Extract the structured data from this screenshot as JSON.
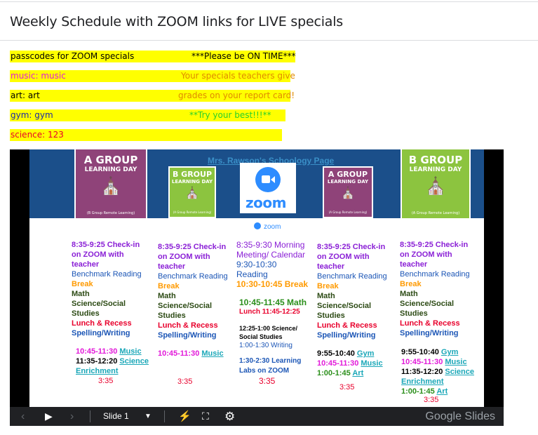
{
  "page": {
    "title": "Weekly Schedule with ZOOM links for LIVE specials"
  },
  "highlights": [
    {
      "left": "passcodes for ZOOM specials",
      "right": "***Please be ON TIME***",
      "left_color": "#000000",
      "right_color": "#000000"
    },
    {
      "left": "music: music",
      "right": "Your specials teachers give",
      "left_color": "#e21ad9",
      "right_color": "#e08a00"
    },
    {
      "left": "art: art",
      "right": "grades on your report card!",
      "left_color": "#000000",
      "right_color": "#e08a00"
    },
    {
      "left": "gym: gym",
      "right": "**Try your best!!!**",
      "left_color": "#1c2aa6",
      "right_color": "#2ad12a"
    },
    {
      "left": "science: 123",
      "right": "",
      "left_color": "#e8002c",
      "right_color": "#000000"
    }
  ],
  "slide": {
    "schoology_link": "Mrs. Rawson's Schoology Page",
    "badges": {
      "a_line1": "A GROUP",
      "a_line2": "LEARNING DAY",
      "a_foot": "(A Group Remote Learning)",
      "a_foot_b": "(B Group Remote Learning)",
      "b_line1": "B GROUP",
      "b_line2": "LEARNING DAY",
      "b_foot": "(A Group Remote Learning)"
    },
    "zoom_word": "zoom",
    "zoom_small": "zoom",
    "columns": {
      "mon": {
        "checkin": [
          "8:35-9:25 Check-in",
          "on ZOOM with",
          "teacher"
        ],
        "reading": "Benchmark Reading",
        "break": "Break",
        "math": "Math",
        "science": [
          "Science/Social",
          "Studies"
        ],
        "lunch": "Lunch & Recess",
        "spelling": "Spelling/Writing",
        "music_time": "10:45-11:30",
        "music": "Music",
        "sci_time": "11:35-12:20",
        "sci": "Science",
        "enrich": "Enrichment",
        "end": "3:35"
      },
      "tue": {
        "checkin": [
          "8:35-9:25 Check-in",
          "on ZOOM with",
          "teacher"
        ],
        "reading": "Benchmark Reading",
        "break": "Break",
        "math": "Math",
        "science": [
          "Science/Social",
          "Studies"
        ],
        "lunch": "Lunch & Recess",
        "spelling": "Spelling/Writing",
        "music_time": "10:45-11:30",
        "music": "Music",
        "end": "3:35"
      },
      "wed": {
        "morning": [
          "8:35-9:30 Morning",
          "Meeting/ Calendar",
          "9:30-10:30",
          "Reading"
        ],
        "break": "10:30-10:45 Break",
        "math": "10:45-11:45 Math",
        "lunch": "Lunch 11:45-12:25",
        "science": [
          "12:25-1:00 Science/",
          "Social Studies"
        ],
        "writing": "1:00-1:30 Writing",
        "labs": [
          "1:30-2:30 Learning",
          "Labs on ZOOM"
        ],
        "end": "3:35"
      },
      "thu": {
        "checkin": [
          "8:35-9:25 Check-in",
          "on ZOOM with",
          "teacher"
        ],
        "reading": "Benchmark Reading",
        "break": "Break",
        "math": "Math",
        "science": [
          "Science/Social",
          "Studies"
        ],
        "lunch": "Lunch & Recess",
        "spelling": "Spelling/Writing",
        "gym_time": "9:55-10:40",
        "gym": "Gym",
        "music_time": "10:45-11:30",
        "music": "Music",
        "art_time": "1:00-1:45",
        "art": "Art",
        "end": "3:35"
      },
      "fri": {
        "checkin": [
          "8:35-9:25 Check-in",
          "on ZOOM with",
          "teacher"
        ],
        "reading": "Benchmark Reading",
        "break": "Break",
        "math": "Math",
        "science": [
          "Science/Social",
          "Studies"
        ],
        "lunch": "Lunch & Recess",
        "spelling": "Spelling/Writing",
        "gym_time": "9:55-10:40",
        "gym": "Gym",
        "music_time": "10:45-11:30",
        "music": "Music",
        "sci_time": "11:35-12:20",
        "sci": "Science",
        "enrich": "Enrichment",
        "art_time": "1:00-1:45",
        "art": "Art",
        "end": "3:35"
      }
    }
  },
  "controls": {
    "slide_label": "Slide 1",
    "brand": "Google Slides",
    "icons": [
      "previous-icon",
      "play-icon",
      "next-icon",
      "dropdown-icon",
      "laser-pointer-icon",
      "fullscreen-icon",
      "settings-icon"
    ]
  }
}
